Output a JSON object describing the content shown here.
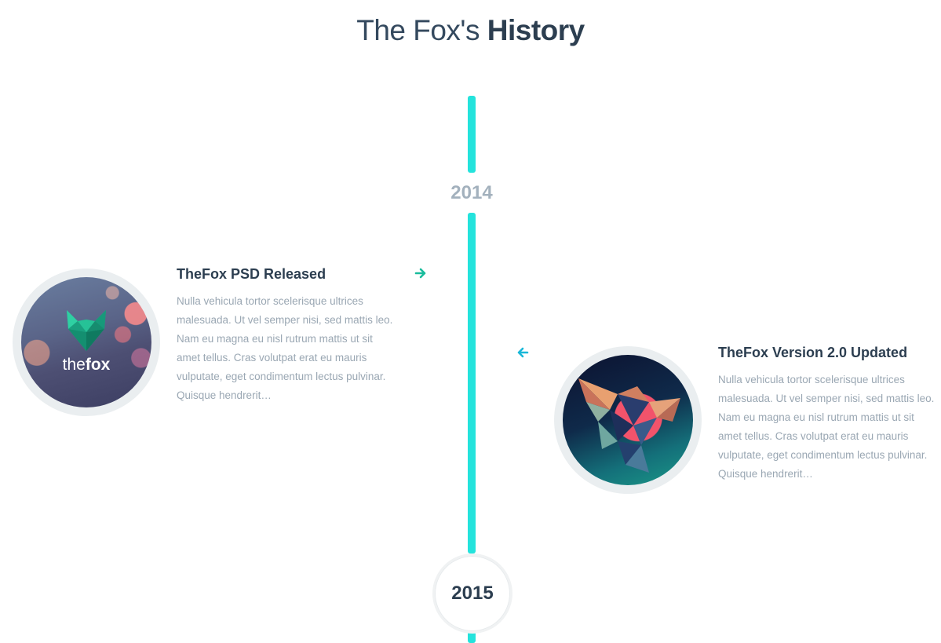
{
  "header": {
    "title_light": "The Fox's",
    "title_bold": "History"
  },
  "timeline": {
    "years": [
      "2014",
      "2015"
    ],
    "line_color": "#24e3dc"
  },
  "entries": [
    {
      "title": "TheFox PSD Released",
      "body": "Nulla vehicula tortor scelerisque ultrices malesuada. Ut vel semper nisi, sed mattis leo. Nam eu magna eu nisl rutrum mattis ut sit amet tellus. Cras volutpat erat eu mauris vulputate, eget condimentum lectus pulvinar. Quisque hendrerit…",
      "image": {
        "wordmark_light": "the",
        "wordmark_bold": "fox"
      },
      "arrow_icon": "arrow-right-icon",
      "arrow_color": "#1abc9c"
    },
    {
      "title": "TheFox Version 2.0 Updated",
      "body": "Nulla vehicula tortor scelerisque ultrices malesuada. Ut vel semper nisi, sed mattis leo. Nam eu magna eu nisl rutrum mattis ut sit amet tellus. Cras volutpat erat eu mauris vulputate, eget condimentum lectus pulvinar. Quisque hendrerit…",
      "arrow_icon": "arrow-left-icon",
      "arrow_color": "#1ab8d8"
    }
  ],
  "colors": {
    "heading": "#2c3e50",
    "muted_text": "#9aa7b3",
    "year_muted": "#a3b1bd"
  }
}
